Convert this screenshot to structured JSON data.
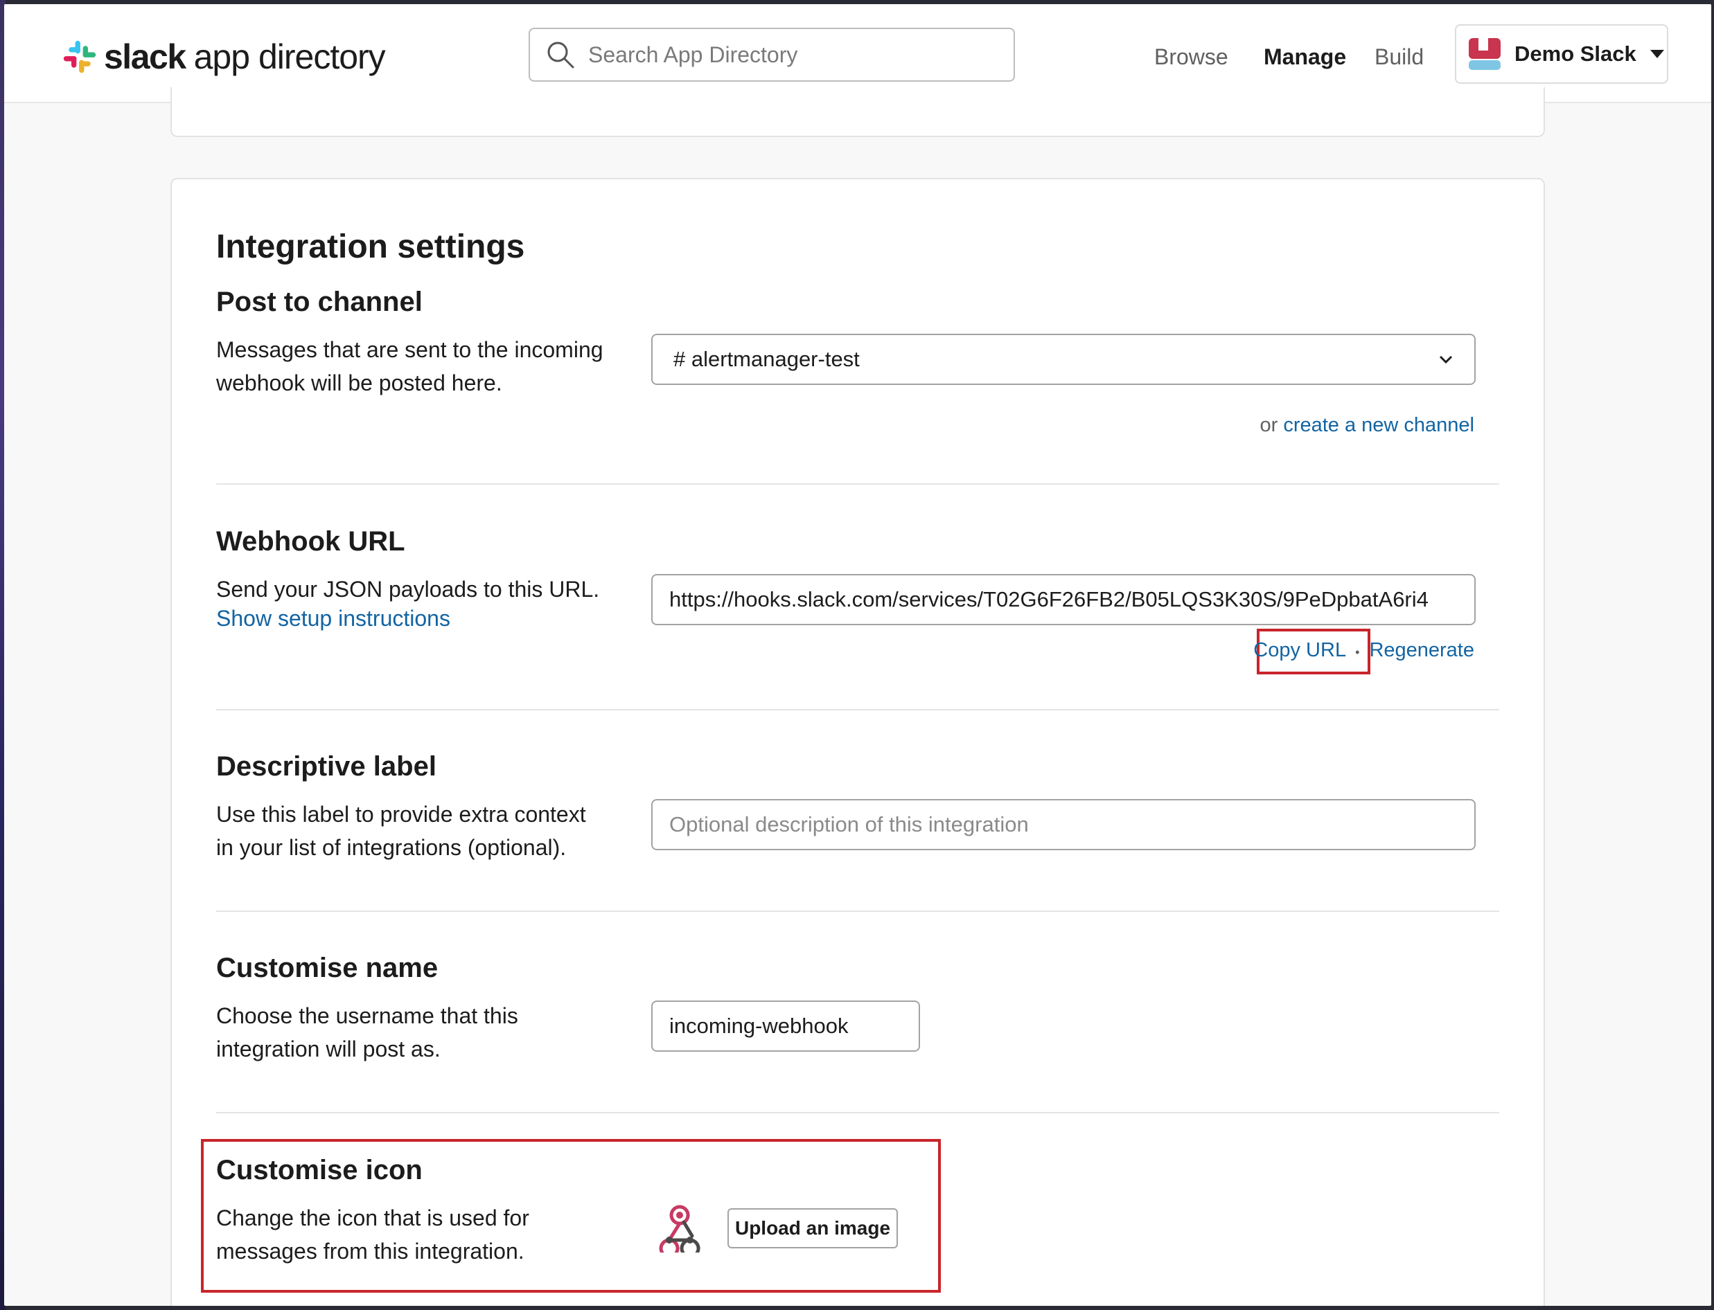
{
  "header": {
    "brand_bold": "slack",
    "brand_rest": "app directory",
    "search_placeholder": "Search App Directory",
    "nav": {
      "browse": "Browse",
      "manage": "Manage",
      "build": "Build"
    },
    "workspace_name": "Demo Slack"
  },
  "card": {
    "title": "Integration settings",
    "post_to_channel": {
      "title": "Post to channel",
      "desc": "Messages that are sent to the incoming webhook will be posted here.",
      "selected_channel": "# alertmanager-test",
      "or_text": "or",
      "create_link": "create a new channel"
    },
    "webhook_url": {
      "title": "Webhook URL",
      "desc": "Send your JSON payloads to this URL.",
      "setup_link": "Show setup instructions",
      "value": "https://hooks.slack.com/services/T02G6F26FB2/B05LQS3K30S/9PeDpbatA6ri4",
      "copy_label": "Copy URL",
      "separator": "•",
      "regenerate_label": "Regenerate"
    },
    "descriptive_label": {
      "title": "Descriptive label",
      "desc": "Use this label to provide extra context in your list of integrations (optional).",
      "placeholder": "Optional description of this integration"
    },
    "customise_name": {
      "title": "Customise name",
      "desc": "Choose the username that this integration will post as.",
      "value": "incoming-webhook"
    },
    "customise_icon": {
      "title": "Customise icon",
      "desc": "Change the icon that is used for messages from this integration.",
      "upload_label": "Upload an image"
    }
  },
  "colors": {
    "link": "#1264a3",
    "highlight": "#c8252c",
    "text": "#1d1c1d"
  }
}
